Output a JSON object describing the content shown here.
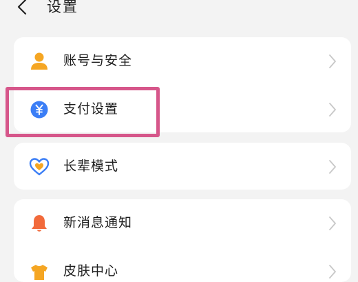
{
  "header": {
    "title": "设置"
  },
  "settings_groups": [
    {
      "items": [
        {
          "label": "账号与安全",
          "icon": "user-icon",
          "icon_color": "#f5a623"
        },
        {
          "label": "支付设置",
          "icon": "yuan-icon",
          "icon_color": "#3b7ef6"
        }
      ]
    },
    {
      "items": [
        {
          "label": "长辈模式",
          "icon": "heart-icon",
          "icon_color": "#3b7ef6"
        }
      ]
    },
    {
      "items": [
        {
          "label": "新消息通知",
          "icon": "bell-icon",
          "icon_color": "#f26a3b"
        },
        {
          "label": "皮肤中心",
          "icon": "skin-icon",
          "icon_color": "#f5a623"
        }
      ]
    }
  ],
  "highlight": {
    "target": "支付设置",
    "color": "#d6568a"
  },
  "colors": {
    "background": "#f3f3f3",
    "card": "#ffffff",
    "chevron": "#c8c8c8"
  }
}
